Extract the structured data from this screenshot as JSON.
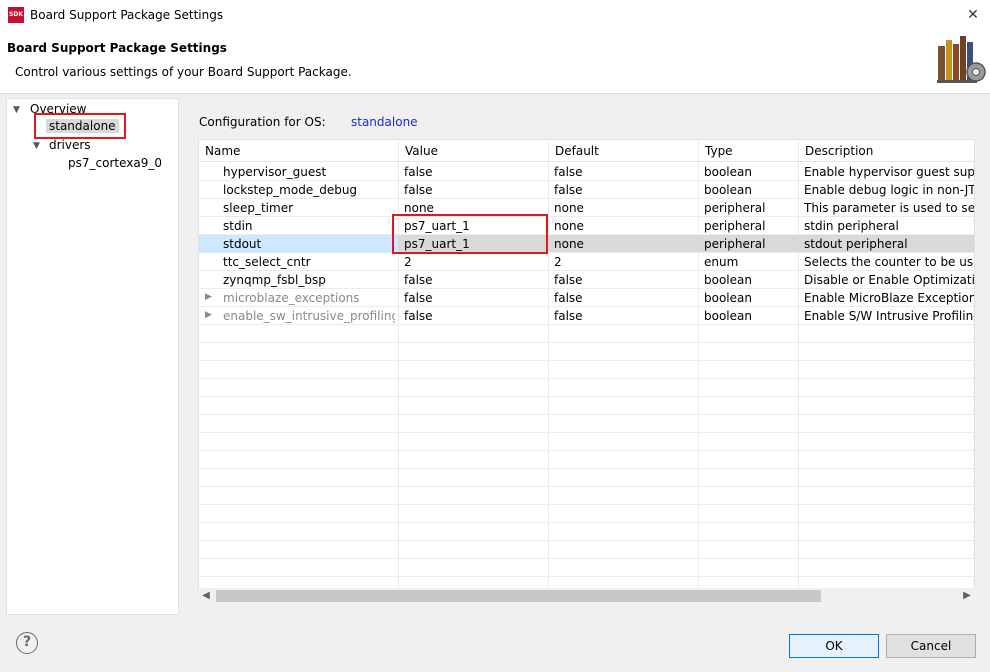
{
  "window": {
    "title": "Board Support Package Settings",
    "app_icon_text": "SDK",
    "close_glyph": "✕"
  },
  "header": {
    "title": "Board Support Package Settings",
    "description": "Control various settings of your Board Support Package.",
    "image_icon": "books-gear-icon"
  },
  "tree": {
    "overview_label": "Overview",
    "standalone_label": "standalone",
    "drivers_label": "drivers",
    "driver_item_label": "ps7_cortexa9_0"
  },
  "config": {
    "label": "Configuration for OS:",
    "value": "standalone"
  },
  "table": {
    "headers": [
      "Name",
      "Value",
      "Default",
      "Type",
      "Description"
    ],
    "rows": [
      {
        "name": "hypervisor_guest",
        "value": "false",
        "default": "false",
        "type": "boolean",
        "description": "Enable hypervisor guest supp"
      },
      {
        "name": "lockstep_mode_debug",
        "value": "false",
        "default": "false",
        "type": "boolean",
        "description": "Enable debug logic in non-JTA"
      },
      {
        "name": "sleep_timer",
        "value": "none",
        "default": "none",
        "type": "peripheral",
        "description": "This parameter is used to sel"
      },
      {
        "name": "stdin",
        "value": "ps7_uart_1",
        "default": "none",
        "type": "peripheral",
        "description": "stdin peripheral"
      },
      {
        "name": "stdout",
        "value": "ps7_uart_1",
        "default": "none",
        "type": "peripheral",
        "description": "stdout peripheral"
      },
      {
        "name": "ttc_select_cntr",
        "value": "2",
        "default": "2",
        "type": "enum",
        "description": "Selects the counter to be use"
      },
      {
        "name": "zynqmp_fsbl_bsp",
        "value": "false",
        "default": "false",
        "type": "boolean",
        "description": "Disable or Enable Optimizatio"
      },
      {
        "name": "microblaze_exceptions",
        "value": "false",
        "default": "false",
        "type": "boolean",
        "description": "Enable MicroBlaze Exceptions"
      },
      {
        "name": "enable_sw_intrusive_profiling",
        "value": "false",
        "default": "false",
        "type": "boolean",
        "description": "Enable S/W Intrusive Profiling"
      }
    ]
  },
  "buttons": {
    "ok": "OK",
    "cancel": "Cancel",
    "help": "?"
  },
  "colors": {
    "highlight_red": "#e0171f",
    "link_blue": "#1d2bd3",
    "selection_blue": "#cde8ff",
    "selection_gray": "#d9d9d9"
  }
}
